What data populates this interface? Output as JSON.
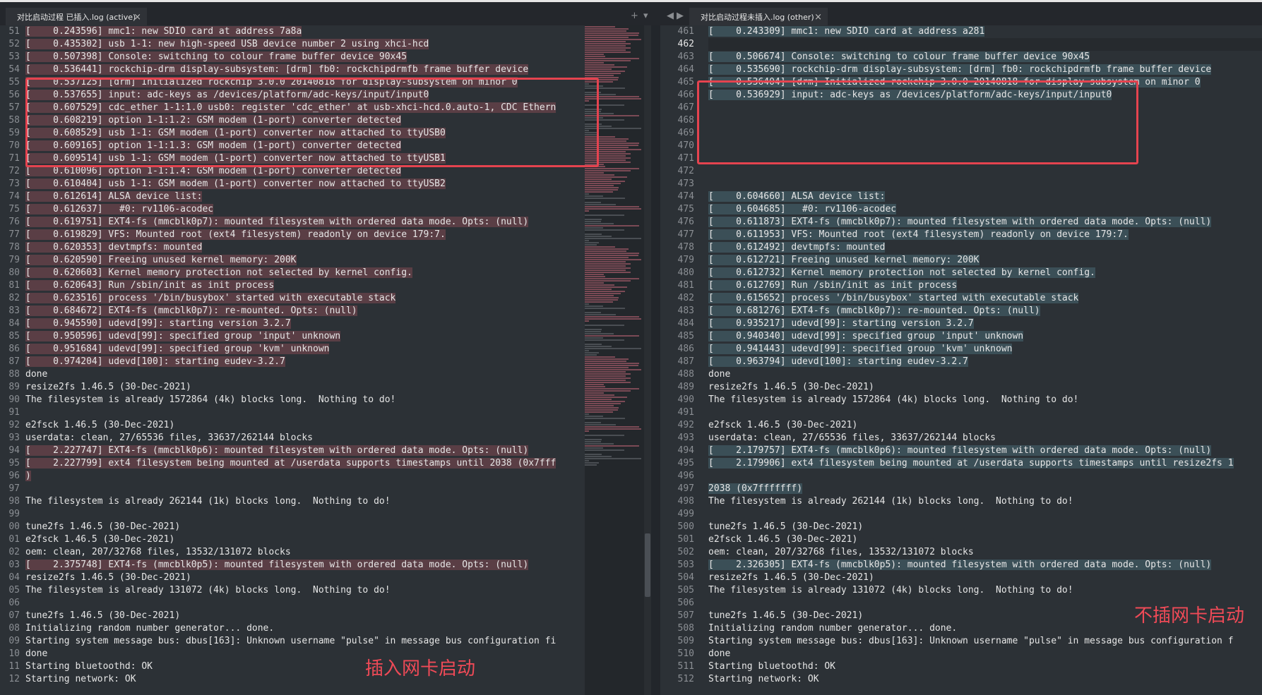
{
  "tabs": {
    "left": {
      "title": "对比启动过程 已插入.log (active)",
      "close": "×"
    },
    "right": {
      "title": "对比启动过程未插入.log (other)",
      "close": "×"
    },
    "controls": {
      "add": "+",
      "menu": "▾",
      "prev": "◀",
      "next": "▶"
    }
  },
  "annotations": {
    "left_label": "插入网卡启动",
    "right_label": "不插网卡启动"
  },
  "colors": {
    "deleted_bg": "#5a3e45",
    "added_bg": "#3b4f57",
    "annotation": "#e5434f"
  },
  "left_pane": {
    "lines": [
      {
        "n": "51",
        "text": "[    0.243596] mmc1: new SDIO card at address 7a8a",
        "hl": true
      },
      {
        "n": "52",
        "text": "[    0.435302] usb 1-1: new high-speed USB device number 2 using xhci-hcd",
        "hl": true
      },
      {
        "n": "53",
        "text": "[    0.507398] Console: switching to colour frame buffer device 90x45",
        "hl": true
      },
      {
        "n": "54",
        "text": "[    0.536441] rockchip-drm display-subsystem: [drm] fb0: rockchipdrmfb frame buffer device",
        "hl": true
      },
      {
        "n": "55",
        "text": "[    0.537125] [drm] Initialized rockchip 3.0.0 20140818 for display-subsystem on minor 0",
        "hl": true
      },
      {
        "n": "56",
        "text": "[    0.537655] input: adc-keys as /devices/platform/adc-keys/input/input0",
        "hl": true
      },
      {
        "n": "57",
        "text": "[    0.607529] cdc_ether 1-1:1.0 usb0: register 'cdc_ether' at usb-xhci-hcd.0.auto-1, CDC Ethern",
        "hl": true
      },
      {
        "n": "58",
        "text": "[    0.608219] option 1-1:1.2: GSM modem (1-port) converter detected",
        "hl": true
      },
      {
        "n": "59",
        "text": "[    0.608529] usb 1-1: GSM modem (1-port) converter now attached to ttyUSB0",
        "hl": true
      },
      {
        "n": "70",
        "text": "[    0.609165] option 1-1:1.3: GSM modem (1-port) converter detected",
        "hl": true
      },
      {
        "n": "71",
        "text": "[    0.609514] usb 1-1: GSM modem (1-port) converter now attached to ttyUSB1",
        "hl": true
      },
      {
        "n": "72",
        "text": "[    0.610096] option 1-1:1.4: GSM modem (1-port) converter detected",
        "hl": true
      },
      {
        "n": "73",
        "text": "[    0.610404] usb 1-1: GSM modem (1-port) converter now attached to ttyUSB2",
        "hl": true
      },
      {
        "n": "74",
        "text": "[    0.612614] ALSA device list:",
        "hl": true
      },
      {
        "n": "75",
        "text": "[    0.612637]   #0: rv1106-acodec",
        "hl": true
      },
      {
        "n": "76",
        "text": "[    0.619751] EXT4-fs (mmcblk0p7): mounted filesystem with ordered data mode. Opts: (null)",
        "hl": true
      },
      {
        "n": "77",
        "text": "[    0.619829] VFS: Mounted root (ext4 filesystem) readonly on device 179:7.",
        "hl": true
      },
      {
        "n": "78",
        "text": "[    0.620353] devtmpfs: mounted",
        "hl": true
      },
      {
        "n": "79",
        "text": "[    0.620590] Freeing unused kernel memory: 200K",
        "hl": true
      },
      {
        "n": "80",
        "text": "[    0.620603] Kernel memory protection not selected by kernel config.",
        "hl": true
      },
      {
        "n": "81",
        "text": "[    0.620643] Run /sbin/init as init process",
        "hl": true
      },
      {
        "n": "82",
        "text": "[    0.623516] process '/bin/busybox' started with executable stack",
        "hl": true
      },
      {
        "n": "83",
        "text": "[    0.684672] EXT4-fs (mmcblk0p7): re-mounted. Opts: (null)",
        "hl": true
      },
      {
        "n": "84",
        "text": "[    0.945590] udevd[99]: starting version 3.2.7",
        "hl": true
      },
      {
        "n": "85",
        "text": "[    0.950596] udevd[99]: specified group 'input' unknown",
        "hl": true
      },
      {
        "n": "86",
        "text": "[    0.951684] udevd[99]: specified group 'kvm' unknown",
        "hl": true
      },
      {
        "n": "87",
        "text": "[    0.974204] udevd[100]: starting eudev-3.2.7",
        "hl": true
      },
      {
        "n": "88",
        "text": "done",
        "hl": false
      },
      {
        "n": "89",
        "text": "resize2fs 1.46.5 (30-Dec-2021)",
        "hl": false
      },
      {
        "n": "90",
        "text": "The filesystem is already 1572864 (4k) blocks long.  Nothing to do!",
        "hl": false
      },
      {
        "n": "91",
        "text": "",
        "hl": false
      },
      {
        "n": "92",
        "text": "e2fsck 1.46.5 (30-Dec-2021)",
        "hl": false
      },
      {
        "n": "93",
        "text": "userdata: clean, 27/65536 files, 33637/262144 blocks",
        "hl": false
      },
      {
        "n": "94",
        "text": "[    2.227747] EXT4-fs (mmcblk0p6): mounted filesystem with ordered data mode. Opts: (null)",
        "hl": true
      },
      {
        "n": "95",
        "text": "[    2.227799] ext4 filesystem being mounted at /userdata supports timestamps until 2038 (0x7fff",
        "hl": true
      },
      {
        "n": "96",
        "text": ")",
        "hl": true
      },
      {
        "n": "97",
        "text": "",
        "hl": false
      },
      {
        "n": "98",
        "text": "The filesystem is already 262144 (1k) blocks long.  Nothing to do!",
        "hl": false
      },
      {
        "n": "99",
        "text": "",
        "hl": false
      },
      {
        "n": "00",
        "text": "tune2fs 1.46.5 (30-Dec-2021)",
        "hl": false
      },
      {
        "n": "01",
        "text": "e2fsck 1.46.5 (30-Dec-2021)",
        "hl": false
      },
      {
        "n": "02",
        "text": "oem: clean, 207/32768 files, 13532/131072 blocks",
        "hl": false
      },
      {
        "n": "03",
        "text": "[    2.375748] EXT4-fs (mmcblk0p5): mounted filesystem with ordered data mode. Opts: (null)",
        "hl": true
      },
      {
        "n": "04",
        "text": "resize2fs 1.46.5 (30-Dec-2021)",
        "hl": false
      },
      {
        "n": "05",
        "text": "The filesystem is already 131072 (4k) blocks long.  Nothing to do!",
        "hl": false
      },
      {
        "n": "06",
        "text": "",
        "hl": false
      },
      {
        "n": "07",
        "text": "tune2fs 1.46.5 (30-Dec-2021)",
        "hl": false
      },
      {
        "n": "08",
        "text": "Initializing random number generator... done.",
        "hl": false
      },
      {
        "n": "09",
        "text": "Starting system message bus: dbus[163]: Unknown username \"pulse\" in message bus configuration fi",
        "hl": false
      },
      {
        "n": "10",
        "text": "done",
        "hl": false
      },
      {
        "n": "11",
        "text": "Starting bluetoothd: OK",
        "hl": false
      },
      {
        "n": "12",
        "text": "Starting network: OK",
        "hl": false
      }
    ]
  },
  "right_pane": {
    "lines": [
      {
        "n": "461",
        "text": "[    0.243309] mmc1: new SDIO card at address a281",
        "hl": true
      },
      {
        "n": "462",
        "text": "",
        "hl": false,
        "cursor": true
      },
      {
        "n": "463",
        "text": "[    0.506674] Console: switching to colour frame buffer device 90x45",
        "hl": true
      },
      {
        "n": "464",
        "text": "[    0.535690] rockchip-drm display-subsystem: [drm] fb0: rockchipdrmfb frame buffer device",
        "hl": true
      },
      {
        "n": "465",
        "text": "[    0.536404] [drm] Initialized rockchip 3.0.0 20140818 for display-subsystem on minor 0",
        "hl": true
      },
      {
        "n": "466",
        "text": "[    0.536929] input: adc-keys as /devices/platform/adc-keys/input/input0",
        "hl": true
      },
      {
        "n": "467",
        "text": "",
        "hl": false
      },
      {
        "n": "468",
        "text": "",
        "hl": false
      },
      {
        "n": "469",
        "text": "",
        "hl": false
      },
      {
        "n": "470",
        "text": "",
        "hl": false
      },
      {
        "n": "471",
        "text": "",
        "hl": false
      },
      {
        "n": "472",
        "text": "",
        "hl": false
      },
      {
        "n": "473",
        "text": "",
        "hl": false
      },
      {
        "n": "474",
        "text": "[    0.604660] ALSA device list:",
        "hl": true
      },
      {
        "n": "475",
        "text": "[    0.604685]   #0: rv1106-acodec",
        "hl": true
      },
      {
        "n": "476",
        "text": "[    0.611873] EXT4-fs (mmcblk0p7): mounted filesystem with ordered data mode. Opts: (null)",
        "hl": true
      },
      {
        "n": "477",
        "text": "[    0.611953] VFS: Mounted root (ext4 filesystem) readonly on device 179:7.",
        "hl": true
      },
      {
        "n": "478",
        "text": "[    0.612492] devtmpfs: mounted",
        "hl": true
      },
      {
        "n": "479",
        "text": "[    0.612721] Freeing unused kernel memory: 200K",
        "hl": true
      },
      {
        "n": "480",
        "text": "[    0.612732] Kernel memory protection not selected by kernel config.",
        "hl": true
      },
      {
        "n": "481",
        "text": "[    0.612769] Run /sbin/init as init process",
        "hl": true
      },
      {
        "n": "482",
        "text": "[    0.615652] process '/bin/busybox' started with executable stack",
        "hl": true
      },
      {
        "n": "483",
        "text": "[    0.681276] EXT4-fs (mmcblk0p7): re-mounted. Opts: (null)",
        "hl": true
      },
      {
        "n": "484",
        "text": "[    0.935217] udevd[99]: starting version 3.2.7",
        "hl": true
      },
      {
        "n": "485",
        "text": "[    0.940340] udevd[99]: specified group 'input' unknown",
        "hl": true
      },
      {
        "n": "486",
        "text": "[    0.941443] udevd[99]: specified group 'kvm' unknown",
        "hl": true
      },
      {
        "n": "487",
        "text": "[    0.963794] udevd[100]: starting eudev-3.2.7",
        "hl": true
      },
      {
        "n": "488",
        "text": "done",
        "hl": false
      },
      {
        "n": "489",
        "text": "resize2fs 1.46.5 (30-Dec-2021)",
        "hl": false
      },
      {
        "n": "490",
        "text": "The filesystem is already 1572864 (4k) blocks long.  Nothing to do!",
        "hl": false
      },
      {
        "n": "491",
        "text": "",
        "hl": false
      },
      {
        "n": "492",
        "text": "e2fsck 1.46.5 (30-Dec-2021)",
        "hl": false
      },
      {
        "n": "493",
        "text": "userdata: clean, 27/65536 files, 33637/262144 blocks",
        "hl": false
      },
      {
        "n": "494",
        "text": "[    2.179757] EXT4-fs (mmcblk0p6): mounted filesystem with ordered data mode. Opts: (null)",
        "hl": true
      },
      {
        "n": "495",
        "text": "[    2.179906] ext4 filesystem being mounted at /userdata supports timestamps until resize2fs 1",
        "hl": true
      },
      {
        "n": "496",
        "text": "",
        "hl": false
      },
      {
        "n": "497",
        "text": "2038 (0x7fffffff)",
        "hl": true
      },
      {
        "n": "498",
        "text": "The filesystem is already 262144 (1k) blocks long.  Nothing to do!",
        "hl": false
      },
      {
        "n": "499",
        "text": "",
        "hl": false
      },
      {
        "n": "500",
        "text": "tune2fs 1.46.5 (30-Dec-2021)",
        "hl": false
      },
      {
        "n": "501",
        "text": "e2fsck 1.46.5 (30-Dec-2021)",
        "hl": false
      },
      {
        "n": "502",
        "text": "oem: clean, 207/32768 files, 13532/131072 blocks",
        "hl": false
      },
      {
        "n": "503",
        "text": "[    2.326305] EXT4-fs (mmcblk0p5): mounted filesystem with ordered data mode. Opts: (null)",
        "hl": true
      },
      {
        "n": "504",
        "text": "resize2fs 1.46.5 (30-Dec-2021)",
        "hl": false
      },
      {
        "n": "505",
        "text": "The filesystem is already 131072 (4k) blocks long.  Nothing to do!",
        "hl": false
      },
      {
        "n": "506",
        "text": "",
        "hl": false
      },
      {
        "n": "507",
        "text": "tune2fs 1.46.5 (30-Dec-2021)",
        "hl": false
      },
      {
        "n": "508",
        "text": "Initializing random number generator... done.",
        "hl": false
      },
      {
        "n": "509",
        "text": "Starting system message bus: dbus[163]: Unknown username \"pulse\" in message bus configuration f",
        "hl": false
      },
      {
        "n": "510",
        "text": "done",
        "hl": false
      },
      {
        "n": "511",
        "text": "Starting bluetoothd: OK",
        "hl": false
      },
      {
        "n": "512",
        "text": "Starting network: OK",
        "hl": false
      }
    ]
  }
}
